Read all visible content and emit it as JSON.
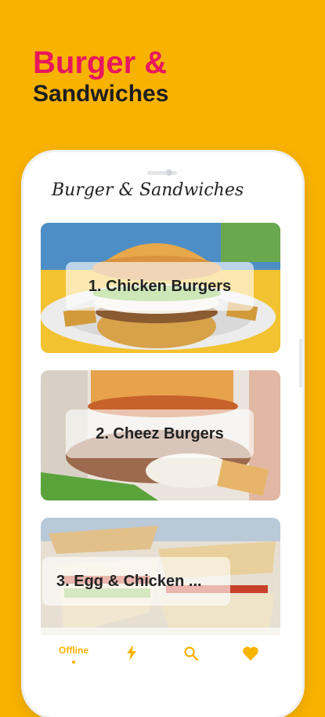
{
  "promo": {
    "line1": "Burger &",
    "line2": "Sandwiches"
  },
  "app": {
    "title": "Burger & Sandwiches"
  },
  "cards": [
    {
      "label": "1. Chicken Burgers"
    },
    {
      "label": "2. Cheez Burgers"
    },
    {
      "label": "3. Egg & Chicken ..."
    }
  ],
  "tabbar": {
    "offline_label": "Offline",
    "icons": [
      "bolt-icon",
      "search-icon",
      "heart-icon"
    ]
  },
  "colors": {
    "background": "#f8b200",
    "accent": "#e8175d",
    "tab_active": "#f8b200"
  }
}
